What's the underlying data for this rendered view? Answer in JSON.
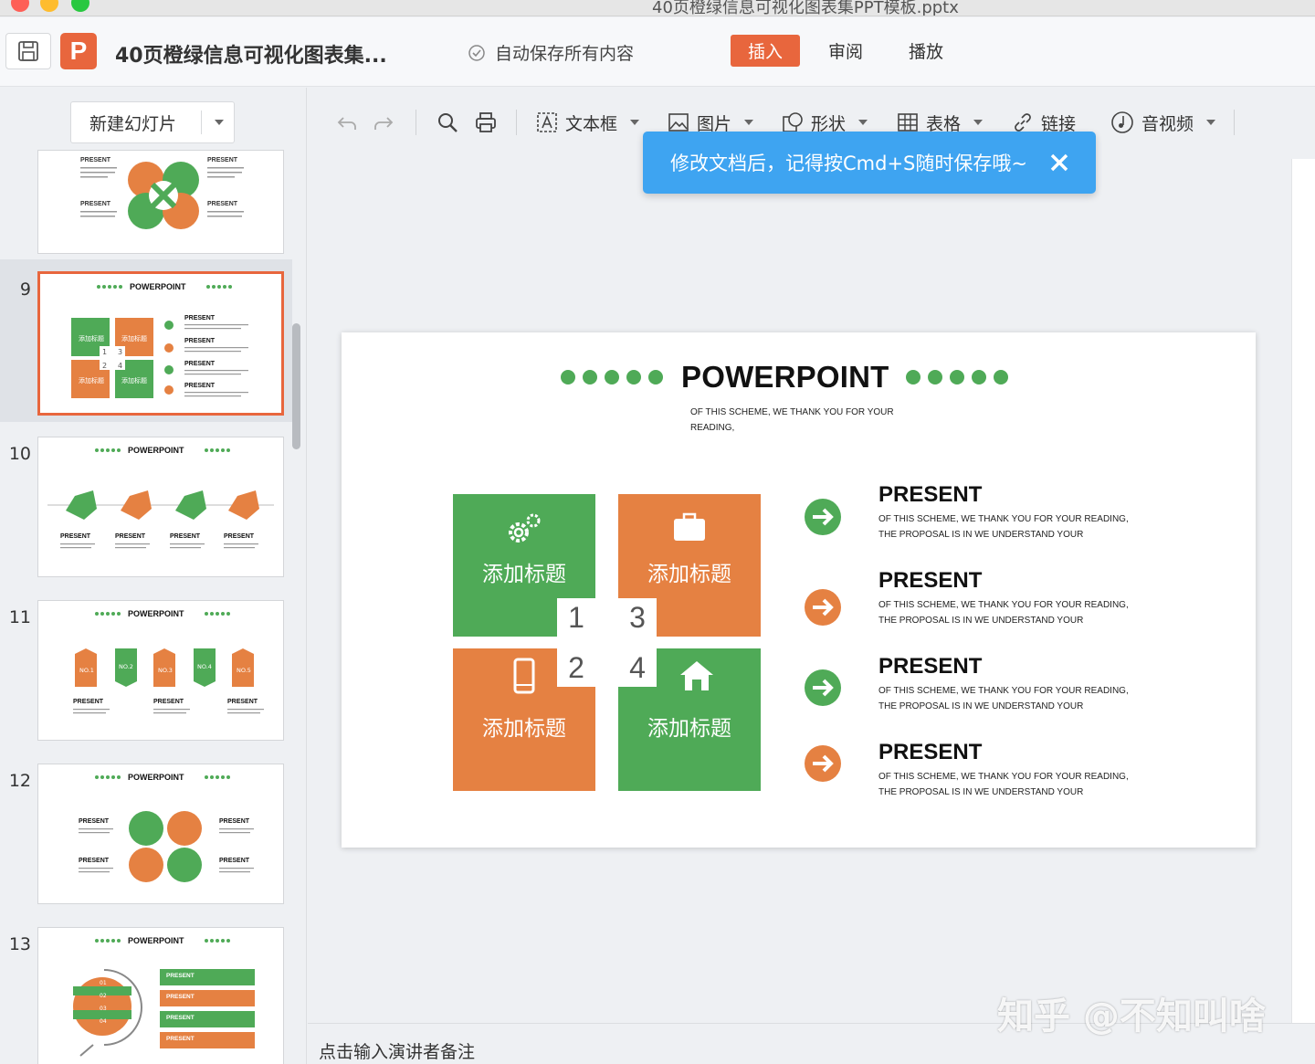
{
  "window": {
    "title": "40页橙绿信息可视化图表集PPT模板.pptx"
  },
  "appbar": {
    "logo": "P",
    "doc_title": "40页橙绿信息可视化图表集...",
    "autosave": "自动保存所有内容",
    "tabs": [
      {
        "label": "插入",
        "active": true
      },
      {
        "label": "审阅",
        "active": false
      },
      {
        "label": "播放",
        "active": false
      }
    ]
  },
  "sidebar": {
    "new_slide": "新建幻灯片",
    "thumbs": [
      {
        "num": "",
        "title": "",
        "label": "PRESENT"
      },
      {
        "num": "9",
        "title": "POWERPOINT",
        "label": "PRESENT",
        "tile": "添加标题",
        "nums": [
          "1",
          "2",
          "3",
          "4"
        ],
        "selected": true
      },
      {
        "num": "10",
        "title": "POWERPOINT",
        "label": "PRESENT"
      },
      {
        "num": "11",
        "title": "POWERPOINT",
        "label": "PRESENT",
        "tags": [
          "NO.1",
          "NO.2",
          "NO.3",
          "NO.4",
          "NO.5"
        ]
      },
      {
        "num": "12",
        "title": "POWERPOINT",
        "label": "PRESENT"
      },
      {
        "num": "13",
        "title": "POWERPOINT",
        "label": "PRESENT",
        "steps": [
          "01",
          "02",
          "03",
          "04"
        ]
      }
    ]
  },
  "toolbar": {
    "textbox": "文本框",
    "picture": "图片",
    "shape": "形状",
    "table": "表格",
    "link": "链接",
    "media": "音视频"
  },
  "toast": {
    "message": "修改文档后，记得按Cmd+S随时保存哦~"
  },
  "slide": {
    "title": "POWERPOINT",
    "subtitle": "OF THIS SCHEME, WE THANK YOU FOR YOUR READING,",
    "tiles": [
      {
        "label": "添加标题",
        "num": "1",
        "color": "#4faa57",
        "icon": "gears-icon"
      },
      {
        "label": "添加标题",
        "num": "3",
        "color": "#e58142",
        "icon": "briefcase-icon"
      },
      {
        "label": "添加标题",
        "num": "2",
        "color": "#e58142",
        "icon": "phone-icon"
      },
      {
        "label": "添加标题",
        "num": "4",
        "color": "#4faa57",
        "icon": "home-icon"
      }
    ],
    "items": [
      {
        "heading": "PRESENT",
        "line1": "OF THIS SCHEME, WE THANK YOU FOR YOUR READING,",
        "line2": "THE PROPOSAL IS IN WE UNDERSTAND YOUR",
        "arrow_color": "#4faa57"
      },
      {
        "heading": "PRESENT",
        "line1": "OF THIS SCHEME, WE THANK YOU FOR YOUR READING,",
        "line2": "THE PROPOSAL IS IN WE UNDERSTAND YOUR",
        "arrow_color": "#e58142"
      },
      {
        "heading": "PRESENT",
        "line1": "OF THIS SCHEME, WE THANK YOU FOR YOUR READING,",
        "line2": "THE PROPOSAL IS IN WE UNDERSTAND YOUR",
        "arrow_color": "#4faa57"
      },
      {
        "heading": "PRESENT",
        "line1": "OF THIS SCHEME, WE THANK YOU FOR YOUR READING,",
        "line2": "THE PROPOSAL IS IN WE UNDERSTAND YOUR",
        "arrow_color": "#e58142"
      }
    ]
  },
  "notes": {
    "placeholder": "点击输入演讲者备注"
  },
  "watermark": "知乎 @不知叫啥",
  "colors": {
    "accent": "#e8663d",
    "green": "#4faa57",
    "orange": "#e58142",
    "toast": "#3ea4f1"
  }
}
